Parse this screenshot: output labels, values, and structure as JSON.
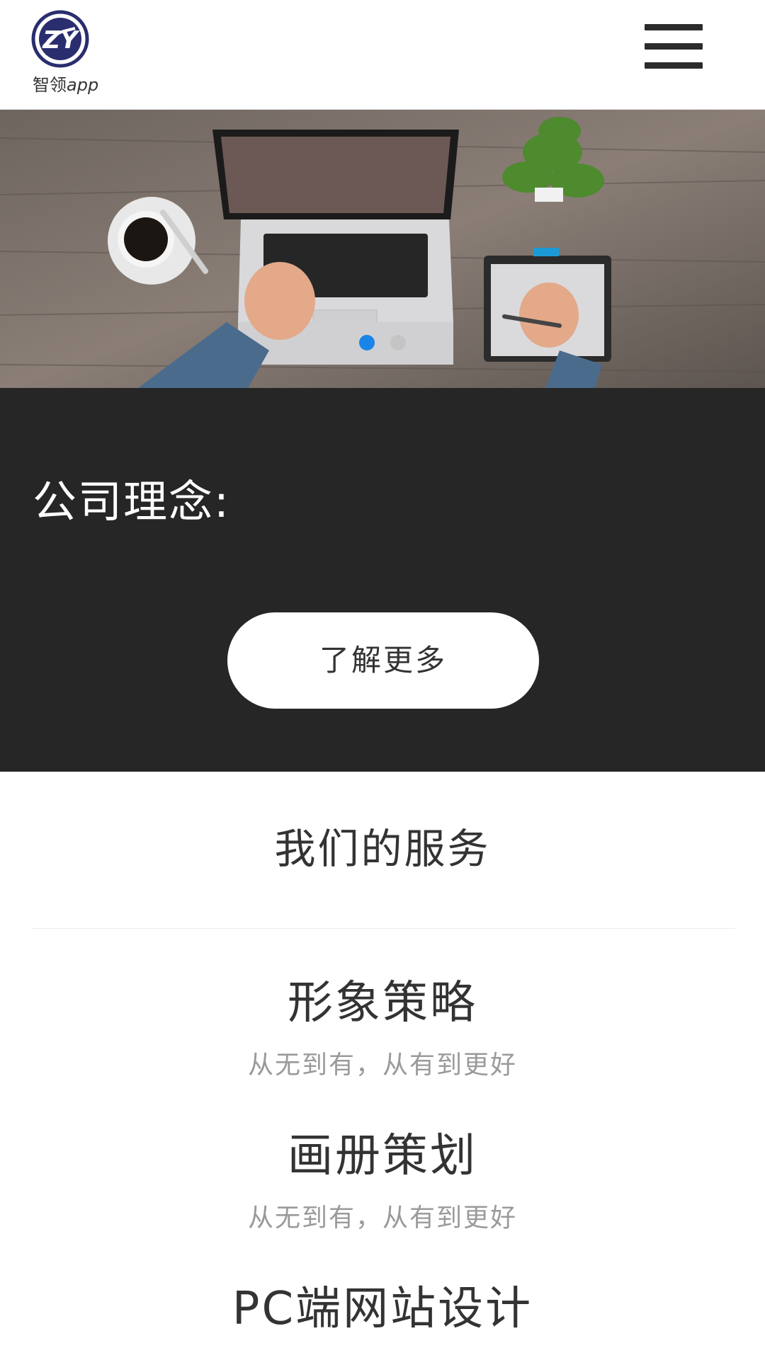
{
  "header": {
    "logo_mark": "ZY",
    "logo_text_cn": "智领",
    "logo_text_app": "app",
    "menu_icon": "hamburger-menu-icon"
  },
  "banner": {
    "slides_count": 2,
    "active_slide": 1
  },
  "philosophy": {
    "title": "公司理念:",
    "button_label": "了解更多"
  },
  "services": {
    "title": "我们的服务",
    "items": [
      {
        "name": "形象策略",
        "desc": "从无到有，从有到更好"
      },
      {
        "name": "画册策划",
        "desc": "从无到有，从有到更好"
      },
      {
        "name": "PC端网站设计",
        "desc": ""
      }
    ]
  },
  "colors": {
    "accent": "#1a84e8",
    "dark_section": "#262626",
    "logo_blue": "#2a2e6e"
  }
}
